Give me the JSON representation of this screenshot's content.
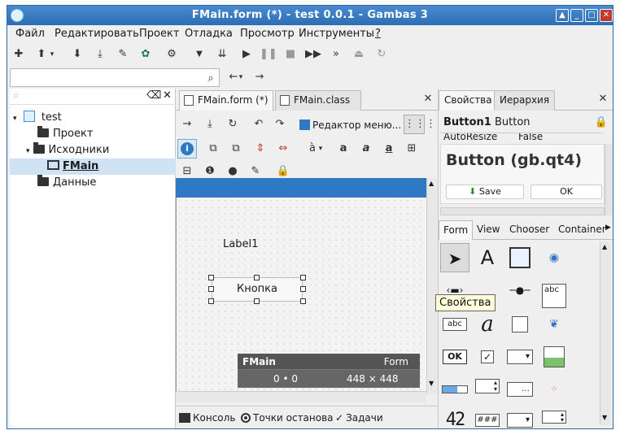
{
  "window": {
    "title": "FMain.form (*) - test 0.0.1 - Gambas 3"
  },
  "menu": [
    "Файл",
    "Редактировать",
    "Проект",
    "Отладка",
    "Просмотр",
    "Инструменты",
    "?"
  ],
  "tree": {
    "root": "test",
    "items": [
      "Проект",
      "Исходники",
      "FMain",
      "Данные"
    ]
  },
  "editor": {
    "tabs": [
      "FMain.form (*)",
      "FMain.class"
    ],
    "menu_editor_label": "Редактор меню...",
    "format_a_label": "à",
    "label1_text": "Label1",
    "button_text": "Кнопка",
    "info": {
      "name": "FMain",
      "type": "Form",
      "pos": "0 • 0",
      "size": "448 × 448"
    }
  },
  "bottom": {
    "console": "Консоль",
    "breakpoints": "Точки останова",
    "tasks": "Задачи"
  },
  "properties": {
    "tabs": [
      "Свойства",
      "Иерархия"
    ],
    "object_name": "Button1",
    "object_type": "Button",
    "prop_name": "AutoResize",
    "prop_value": "False",
    "preview_title": "Button (gb.qt4)",
    "preview_save": "Save",
    "preview_ok": "OK"
  },
  "toolbox": {
    "tabs": [
      "Form",
      "View",
      "Chooser",
      "Container"
    ],
    "label_a": "A",
    "text_abc": "abc",
    "ok": "OK",
    "hash": "###",
    "lcd": "42",
    "italic_a": "a"
  },
  "tooltip": "Свойства"
}
